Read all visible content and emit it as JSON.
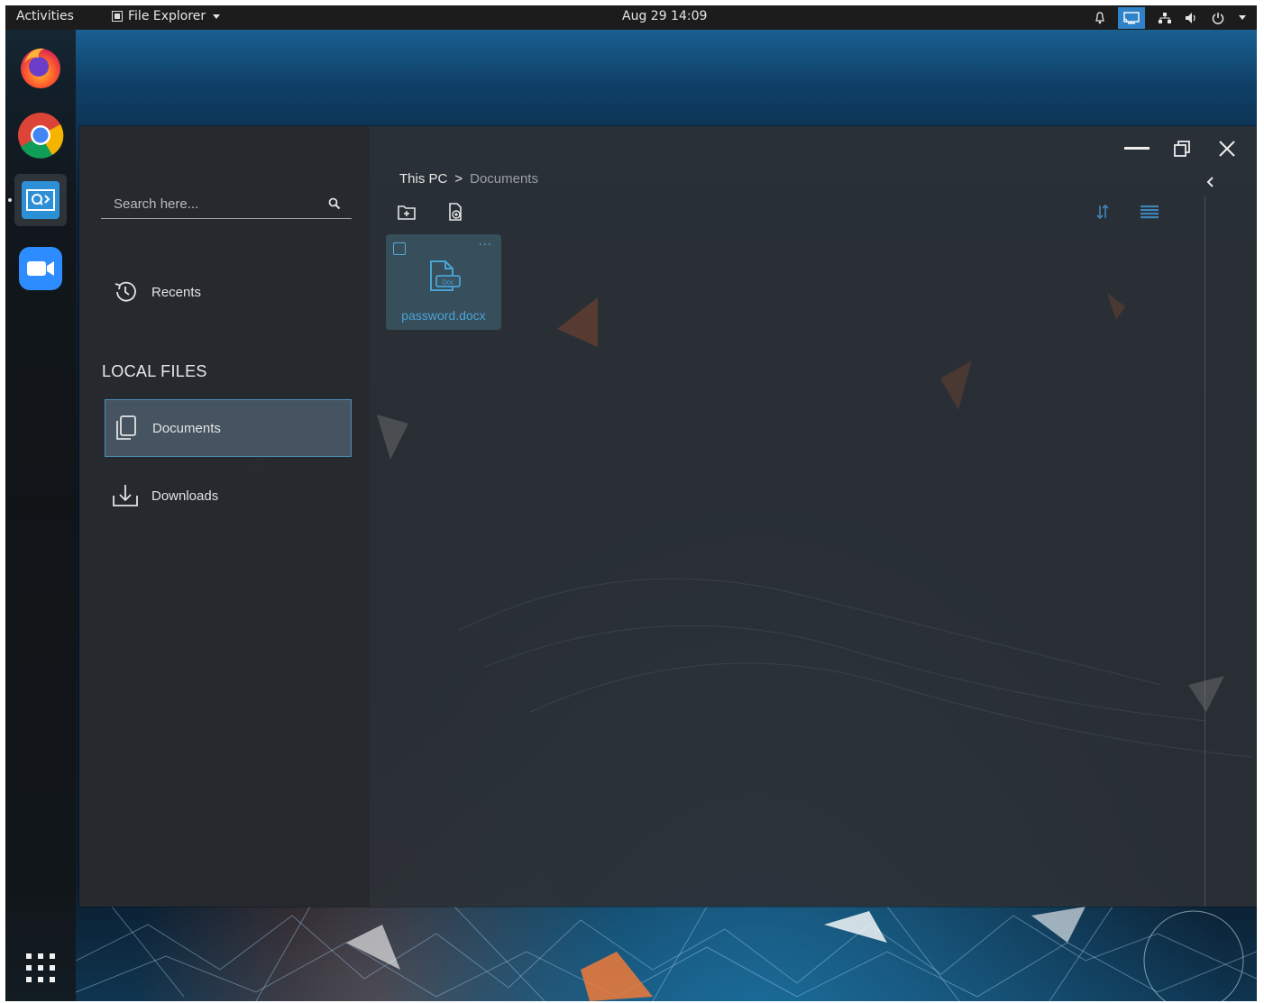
{
  "topbar": {
    "activities_label": "Activities",
    "app_menu_label": "File Explorer",
    "clock": "Aug 29  14:09",
    "tray_icons": [
      "bell-icon",
      "screencast-icon",
      "network-icon",
      "volume-icon",
      "power-icon",
      "chevron-down-icon"
    ]
  },
  "dock": {
    "items": [
      {
        "name": "Firefox",
        "icon": "firefox-icon"
      },
      {
        "name": "Chrome",
        "icon": "chrome-icon"
      },
      {
        "name": "File Explorer",
        "icon": "file-explorer-icon",
        "active": true
      },
      {
        "name": "Zoom",
        "icon": "zoom-icon"
      },
      {
        "name": "Show Applications",
        "icon": "app-grid-icon"
      }
    ]
  },
  "sidebar": {
    "search_placeholder": "Search here...",
    "recents_label": "Recents",
    "local_files_heading": "LOCAL FILES",
    "items": [
      {
        "label": "Documents",
        "icon": "documents-icon",
        "selected": true
      },
      {
        "label": "Downloads",
        "icon": "downloads-icon",
        "selected": false
      }
    ]
  },
  "breadcrumb": {
    "root": "This PC",
    "separator": ">",
    "current": "Documents"
  },
  "toolbar": {
    "new_folder_icon": "new-folder-icon",
    "new_file_icon": "new-file-icon",
    "sort_icon": "sort-icon",
    "list_view_icon": "list-view-icon"
  },
  "files": [
    {
      "name": "password.docx",
      "type_badge": "Doc"
    }
  ],
  "colors": {
    "accent": "#4aa3d6",
    "selection_border": "#4a90b8",
    "topbar_bg": "#1c1c1c",
    "window_bg": "#2c3036"
  }
}
